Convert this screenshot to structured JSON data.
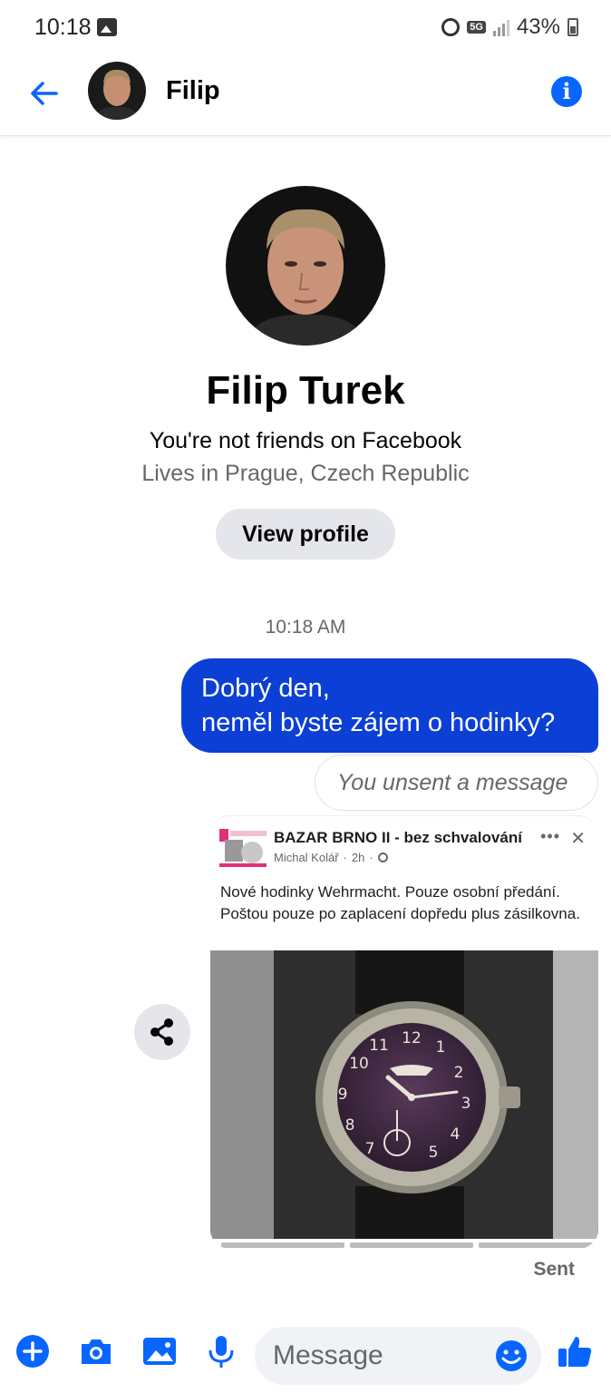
{
  "status_bar": {
    "time": "10:18",
    "network": "5G",
    "battery": "43%"
  },
  "header": {
    "contact_name": "Filip"
  },
  "profile": {
    "full_name": "Filip Turek",
    "friend_status": "You're not friends on Facebook",
    "location": "Lives in Prague, Czech Republic",
    "view_profile_label": "View profile"
  },
  "conversation": {
    "timestamp": "10:18 AM",
    "outgoing_message_line1": "Dobrý den,",
    "outgoing_message_line2": "neměl byste zájem o hodinky?",
    "unsent_notice": "You unsent a message",
    "delivery_status": "Sent"
  },
  "shared_post": {
    "group_name": "BAZAR BRNO II - bez schvalování",
    "author": "Michal Kolář",
    "age": "2h",
    "text": "Nové hodinky Wehrmacht. Pouze osobní předání. Poštou pouze po zaplacení dopředu plus zásilkovna.",
    "photo_description_icon": "watch-photo"
  },
  "composer": {
    "placeholder": "Message"
  },
  "colors": {
    "accent": "#0866ff",
    "outgoing_bubble": "#0b3fd6",
    "secondary_text": "#65676b"
  }
}
